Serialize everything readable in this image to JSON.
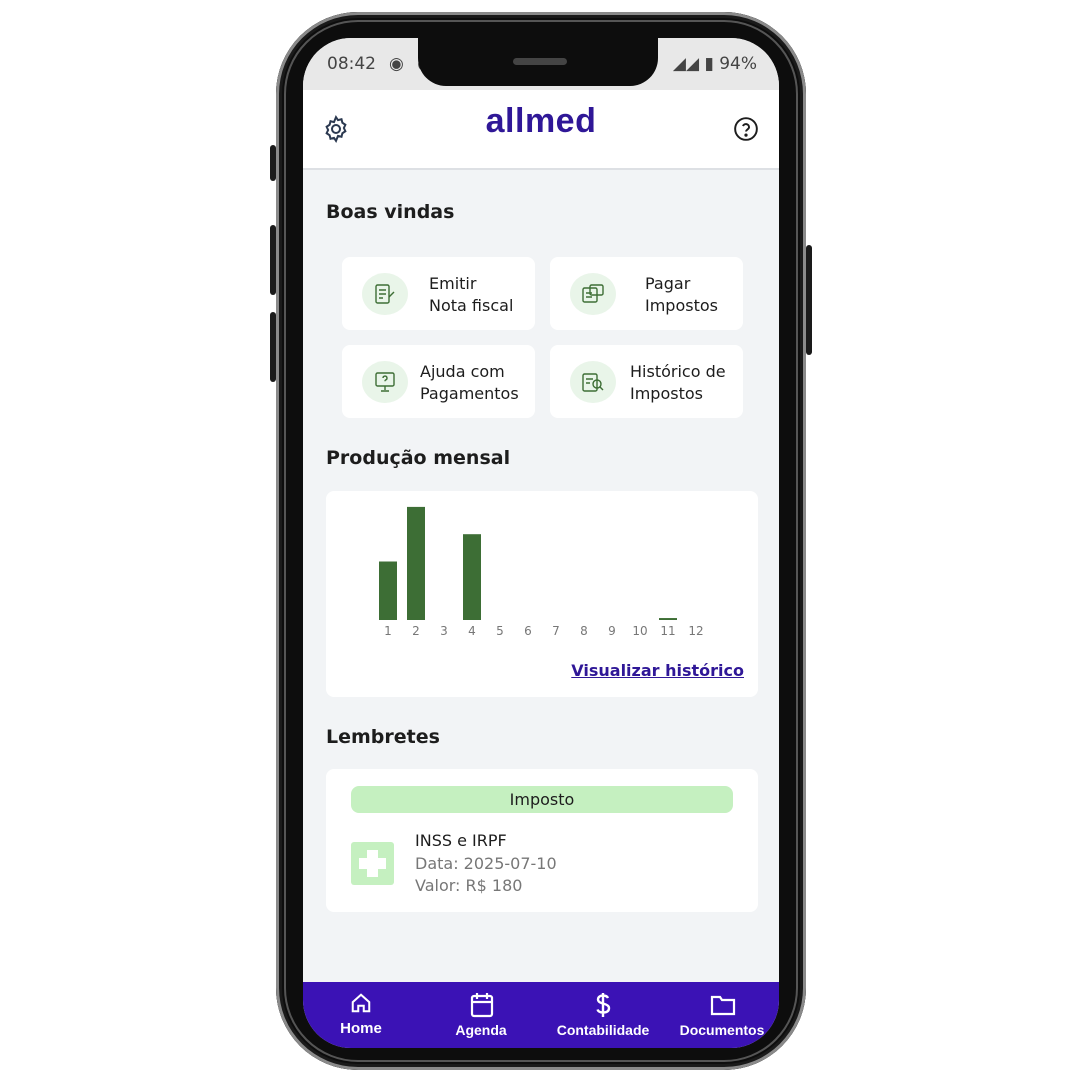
{
  "status_bar": {
    "time": "08:42",
    "left_icons": "◉ ◉",
    "right": "◢◢ ▮ 94%"
  },
  "header": {
    "logo": "allmed"
  },
  "welcome": {
    "title": "Boas vindas"
  },
  "quick_actions": [
    {
      "line1": "Emitir",
      "line2": "Nota fiscal"
    },
    {
      "line1": "Pagar",
      "line2": "Impostos"
    },
    {
      "line1": "Ajuda com",
      "line2": "Pagamentos"
    },
    {
      "line1": "Histórico de",
      "line2": "Impostos"
    }
  ],
  "production": {
    "title": "Produção mensal",
    "link": "Visualizar histórico"
  },
  "chart_data": {
    "type": "bar",
    "categories": [
      "1",
      "2",
      "3",
      "4",
      "5",
      "6",
      "7",
      "8",
      "9",
      "10",
      "11",
      "12"
    ],
    "values": [
      60,
      116,
      0,
      88,
      0,
      0,
      0,
      0,
      0,
      0,
      2,
      0
    ],
    "ylim": [
      0,
      120
    ],
    "bar_color": "#3d6e35",
    "grid": false
  },
  "reminders": {
    "title": "Lembretes",
    "badge": "Imposto",
    "item_title": "INSS e IRPF",
    "date": "Data: 2025-07-10",
    "value": "Valor: R$ 180"
  },
  "nav": {
    "home": "Home",
    "agenda": "Agenda",
    "accounting": "Contabilidade",
    "documents": "Documentos"
  },
  "colors": {
    "brand": "#2f1797",
    "nav_bg": "#3b12b5",
    "accent_green": "#c5f0c0",
    "bar": "#3d6e35"
  }
}
